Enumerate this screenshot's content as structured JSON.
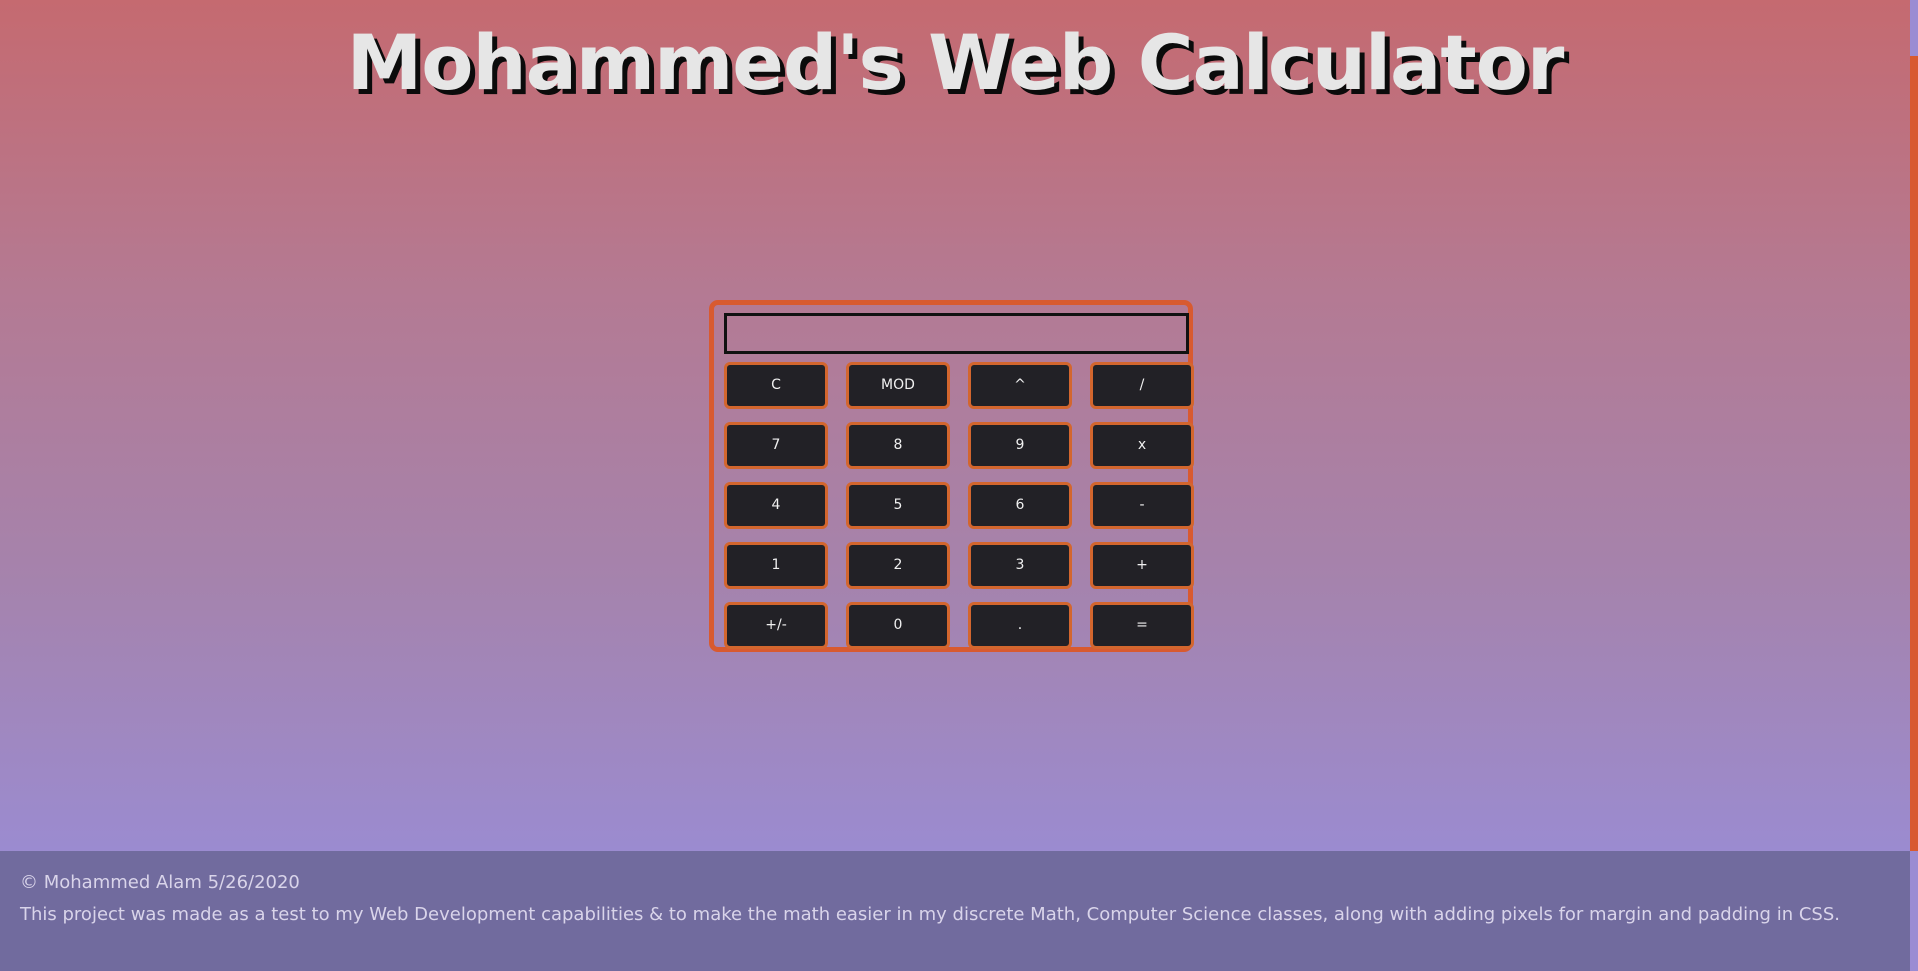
{
  "header": {
    "title": "Mohammed's Web Calculator"
  },
  "calculator": {
    "display_value": "",
    "keys": [
      [
        "C",
        "MOD",
        "^",
        "/"
      ],
      [
        "7",
        "8",
        "9",
        "x"
      ],
      [
        "4",
        "5",
        "6",
        "-"
      ],
      [
        "1",
        "2",
        "3",
        "+"
      ],
      [
        "+/-",
        "0",
        ".",
        "="
      ]
    ]
  },
  "footer": {
    "copyright": "© Mohammed Alam 5/26/2020",
    "description": "This project was made as a test to my Web Development capabilities & to make the math easier in my discrete Math, Computer Science classes, along with adding pixels for margin and padding in CSS."
  },
  "colors": {
    "accent": "#d85a30",
    "key_background": "#222126",
    "footer_background": "#716b9e"
  }
}
